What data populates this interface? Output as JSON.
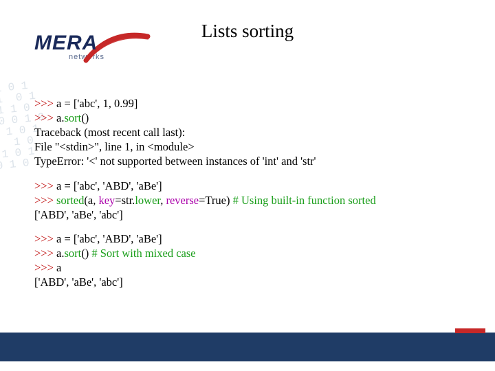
{
  "logo": {
    "main": "MERA",
    "sub": "networks"
  },
  "title": "Lists sorting",
  "blocks": {
    "b1": {
      "l1_code": " a = ['abc', 1, 0.99]",
      "l2_pre": " a.",
      "l2_sort": "sort",
      "l2_post": "()",
      "l3": "Traceback (most recent call last):",
      "l4_a": "  File \"",
      "l4_stdin": "<stdin>",
      "l4_b": "\", line 1, in ",
      "l4_mod": "<module>",
      "l5": "TypeError: '<' not supported between instances of 'int' and 'str'"
    },
    "b2": {
      "l1_code": " a = ['abc', 'ABD', 'aBe']",
      "l2_sorted": "sorted",
      "l2_mid1": "(a, ",
      "l2_key": "key",
      "l2_mid2": "=str.",
      "l2_lower": "lower",
      "l2_mid3": ", ",
      "l2_rev": "reverse",
      "l2_mid4": "=True)  ",
      "l2_comment": "# Using built-in function sorted",
      "l3": "['ABD', 'aBe', 'abc']"
    },
    "b3": {
      "l1_code": " a = ['abc', 'ABD', 'aBe']",
      "l2_pre": " a.",
      "l2_sort": "sort",
      "l2_post": "() ",
      "l2_comment": "# Sort with mixed case",
      "l3_code": " a",
      "l4": "['ABD', 'aBe', 'abc']"
    }
  },
  "prompt": ">>>",
  "space": " ",
  "bg_binary": " 0  1 0 1\n1 0 1  0 1\n  0 1 1 0\n 1  0 0 1 0\n0 1  1 0 1\n 1 0  1 0\n  0 1 0 1\n1  0 1 0"
}
